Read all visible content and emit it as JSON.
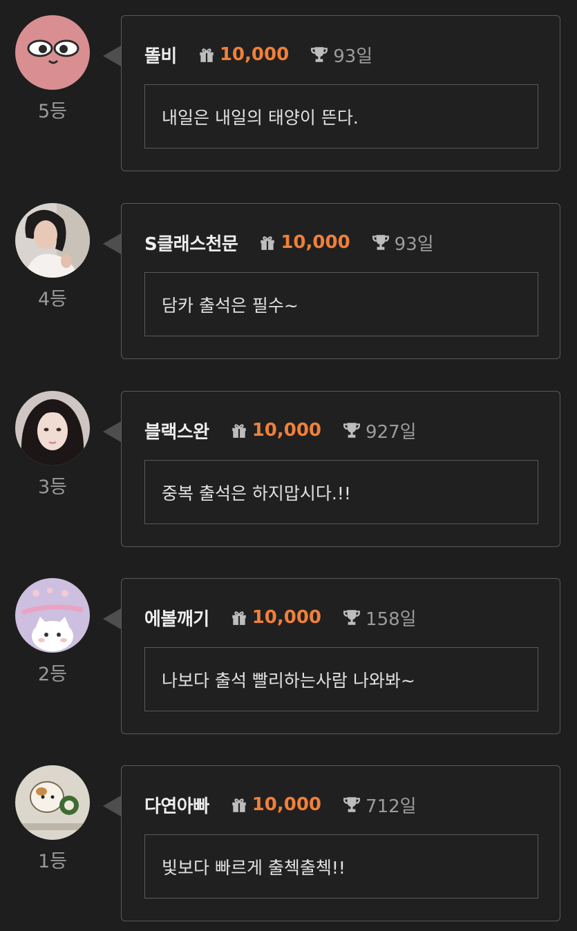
{
  "entries": [
    {
      "rank": "5등",
      "nickname": "똘비",
      "gift_amount": "10,000",
      "days": "93일",
      "message": "내일은 내일의 태양이 뜬다."
    },
    {
      "rank": "4등",
      "nickname": "S클래스천문",
      "gift_amount": "10,000",
      "days": "93일",
      "message": "담카 출석은 필수~"
    },
    {
      "rank": "3등",
      "nickname": "블랙스완",
      "gift_amount": "10,000",
      "days": "927일",
      "message": "중복 출석은 하지맙시다.!!"
    },
    {
      "rank": "2등",
      "nickname": "에볼깨기",
      "gift_amount": "10,000",
      "days": "158일",
      "message": "나보다 출석 빨리하는사람 나와봐~"
    },
    {
      "rank": "1등",
      "nickname": "다연아빠",
      "gift_amount": "10,000",
      "days": "712일",
      "message": "빛보다 빠르게 출첵출첵!!"
    }
  ],
  "icons": {
    "gift": "gift-icon",
    "trophy": "trophy-icon",
    "avatar": "avatar-image"
  },
  "colors": {
    "background": "#1e1e1e",
    "accent_amount": "#f0803a",
    "card_border": "#5a5a5a"
  }
}
